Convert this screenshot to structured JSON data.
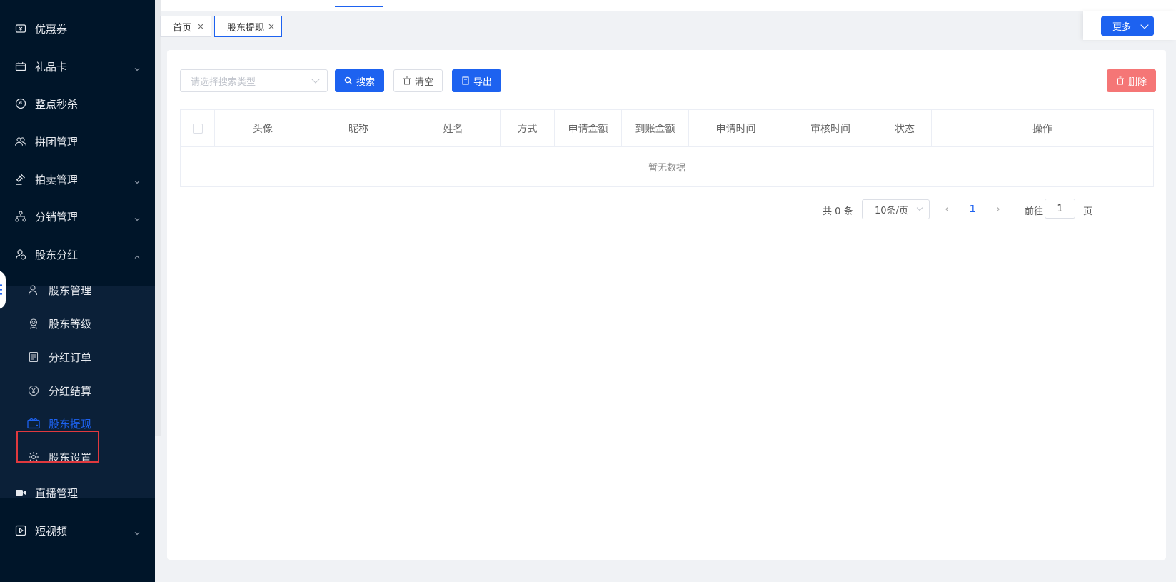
{
  "sidebar": {
    "menu": [
      {
        "label": "优惠券",
        "icon": "ticket-icon",
        "has_arrow": false
      },
      {
        "label": "礼品卡",
        "icon": "gift-card-icon",
        "has_arrow": true
      },
      {
        "label": "整点秒杀",
        "icon": "flash-sale-icon",
        "has_arrow": false
      },
      {
        "label": "拼团管理",
        "icon": "group-buy-icon",
        "has_arrow": false
      },
      {
        "label": "拍卖管理",
        "icon": "auction-gavel-icon",
        "has_arrow": true
      },
      {
        "label": "分销管理",
        "icon": "distribution-icon",
        "has_arrow": true
      },
      {
        "label": "股东分红",
        "icon": "shareholder-icon",
        "has_arrow": true,
        "expanded": true
      }
    ],
    "submenu": [
      {
        "label": "股东管理",
        "icon": "user-icon"
      },
      {
        "label": "股东等级",
        "icon": "badge-icon"
      },
      {
        "label": "分红订单",
        "icon": "document-icon"
      },
      {
        "label": "分红结算",
        "icon": "yuan-icon"
      },
      {
        "label": "股东提现",
        "icon": "wallet-icon",
        "active": true
      },
      {
        "label": "股东设置",
        "icon": "gear-icon"
      }
    ],
    "menu_after": [
      {
        "label": "直播管理",
        "icon": "video-camera-icon",
        "has_arrow": false
      },
      {
        "label": "短视频",
        "icon": "play-box-icon",
        "has_arrow": true
      }
    ]
  },
  "tabs": [
    {
      "label": "首页",
      "close": "×"
    },
    {
      "label": "股东提现",
      "close": "×"
    }
  ],
  "more_button": "更多",
  "toolbar": {
    "search_type_placeholder": "请选择搜索类型",
    "search_label": "搜索",
    "clear_label": "清空",
    "export_label": "导出",
    "delete_label": "删除"
  },
  "table": {
    "columns": [
      "头像",
      "昵称",
      "姓名",
      "方式",
      "申请金额",
      "到账金额",
      "申请时间",
      "审核时间",
      "状态",
      "操作"
    ],
    "empty_text": "暂无数据"
  },
  "pagination": {
    "total_text": "共 0 条",
    "page_size": "10条/页",
    "current_page": "1",
    "goto_label": "前往",
    "goto_value": "1",
    "page_suffix": "页"
  },
  "colors": {
    "sidebar_bg": "#001529",
    "submenu_bg": "#0b2038",
    "primary": "#1d62f0",
    "danger": "#f57676",
    "highlight_box": "#e0393e"
  }
}
